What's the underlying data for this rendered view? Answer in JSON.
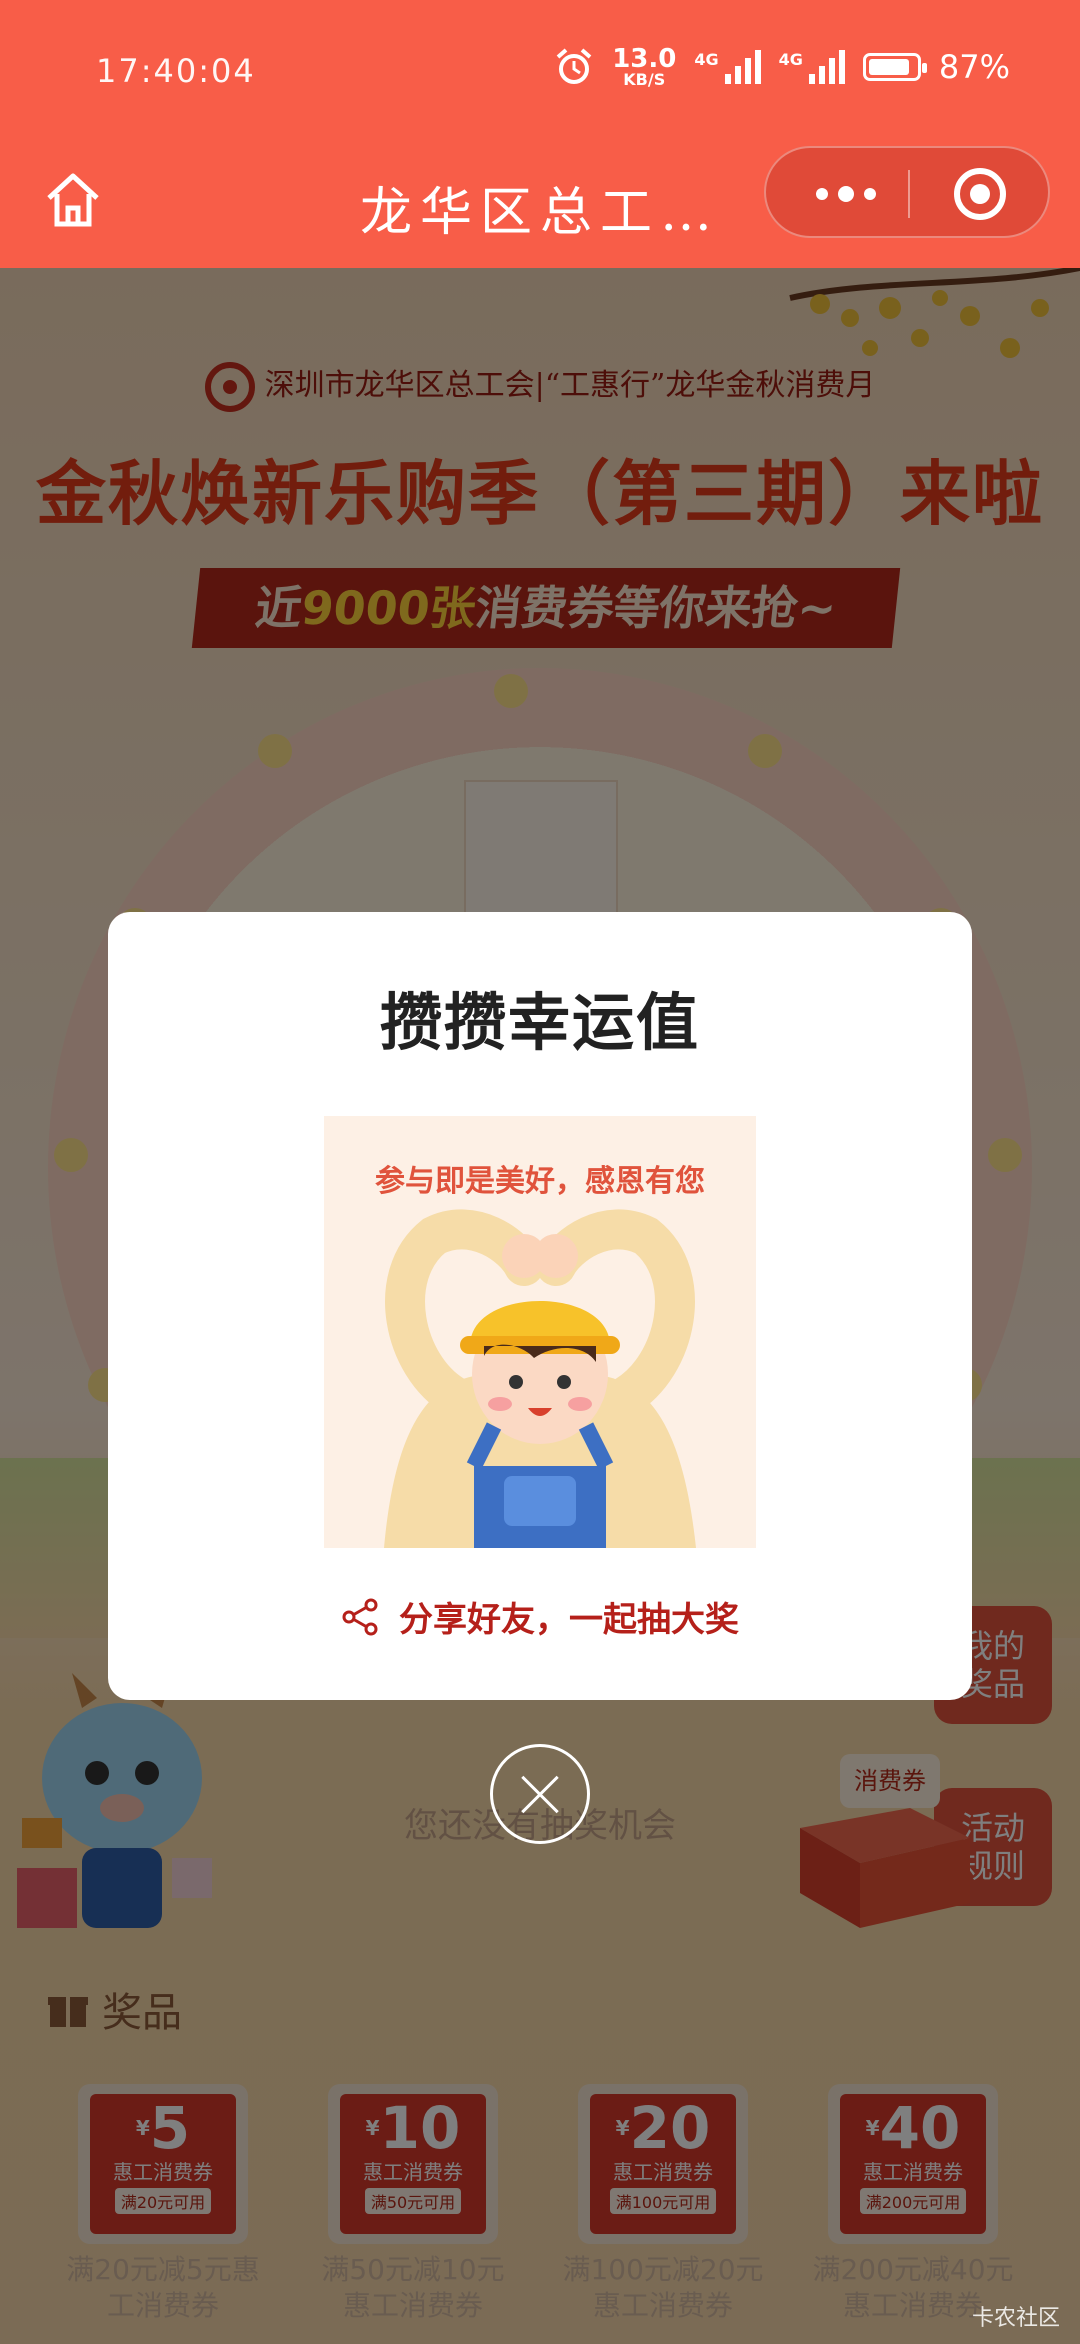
{
  "status_bar": {
    "time": "17:40:04",
    "net_speed": "13.0",
    "net_unit": "KB/S",
    "network_1": "4G",
    "network_2": "4G",
    "battery_text": "87%",
    "battery_level": 0.87,
    "alarm_icon": "alarm-clock-icon"
  },
  "nav": {
    "title": "龙华区总工…",
    "home_icon": "home-icon",
    "more_icon": "more-dots-icon",
    "close_icon": "target-icon"
  },
  "page": {
    "org_line": "深圳市龙华区总工会|“工惠行”龙华金秋消费月",
    "headline": "金秋焕新乐购季（第三期）来啦",
    "ribbon_prefix": "近",
    "ribbon_highlight": "9000张",
    "ribbon_suffix": "消费券等你来抢~",
    "wheel_card_text": "参与即是美好，感恩有您",
    "no_chance_text": "您还没有抽奖机会",
    "side_my_prizes_line1": "我的",
    "side_my_prizes_line2": "奖品",
    "side_rules_line1": "活动",
    "side_rules_line2": "规则",
    "coupon_tag": "消费券",
    "prizes_title": "奖品",
    "coupons": [
      {
        "currency": "¥",
        "amount": "5",
        "name": "惠工消费券",
        "cond": "满20元可用",
        "desc": "满20元减5元惠工消费券"
      },
      {
        "currency": "¥",
        "amount": "10",
        "name": "惠工消费券",
        "cond": "满50元可用",
        "desc": "满50元减10元惠工消费券"
      },
      {
        "currency": "¥",
        "amount": "20",
        "name": "惠工消费券",
        "cond": "满100元可用",
        "desc": "满100元减20元惠工消费券"
      },
      {
        "currency": "¥",
        "amount": "40",
        "name": "惠工消费券",
        "cond": "满200元可用",
        "desc": "满200元减40元惠工消费券"
      }
    ]
  },
  "modal": {
    "title": "攒攒幸运值",
    "image_caption": "参与即是美好，感恩有您",
    "share_text": "分享好友，一起抽大奖",
    "share_icon": "share-icon",
    "close_icon": "close-icon"
  },
  "watermark": "卡农社区",
  "colors": {
    "brand_red": "#f85d48",
    "dark_red": "#b5201a",
    "highlight_yellow": "#ffd23a"
  }
}
